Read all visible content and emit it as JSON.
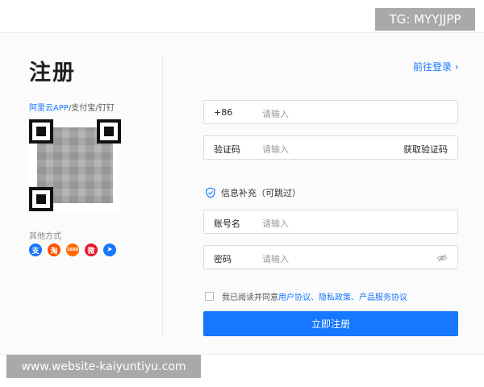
{
  "watermark": {
    "tg": "TG: MYYJJPP",
    "site": "www.website-kaiyuntiyu.com"
  },
  "left": {
    "title": "注册",
    "apps": {
      "blue": "阿里云APP",
      "rest": "/支付宝/钉钉"
    },
    "other_label": "其他方式",
    "social": [
      {
        "name": "alipay-icon",
        "glyph": "支",
        "color": "#1677ff"
      },
      {
        "name": "taobao-icon",
        "glyph": "淘",
        "color": "#ff5000"
      },
      {
        "name": "1688-icon",
        "glyph": "1688",
        "color": "#ff6a00"
      },
      {
        "name": "weibo-icon",
        "glyph": "微",
        "color": "#e6162d"
      },
      {
        "name": "dingtalk-icon",
        "glyph": "➤",
        "color": "#1677ff"
      }
    ]
  },
  "right": {
    "login_link": "前往登录 ›",
    "phone": {
      "prefix": "+86",
      "placeholder": "请输入"
    },
    "code": {
      "label": "验证码",
      "placeholder": "请输入",
      "action": "获取验证码"
    },
    "info": "信息补充（可跳过）",
    "account": {
      "label": "账号名",
      "placeholder": "请输入"
    },
    "password": {
      "label": "密码",
      "placeholder": "请输入"
    },
    "agree": {
      "text": "我已阅读并同意",
      "links": "用户协议、隐私政策、产品服务协议"
    },
    "submit": "立即注册"
  }
}
